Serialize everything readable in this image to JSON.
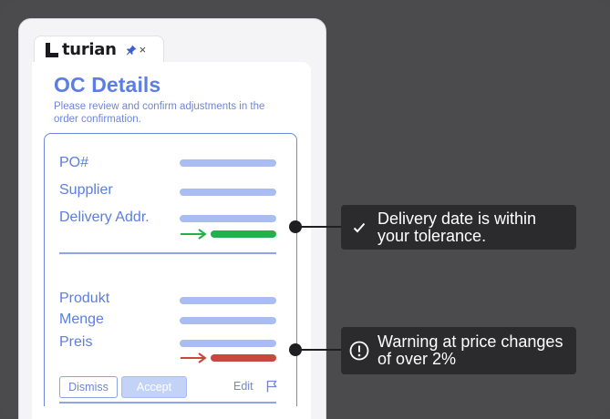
{
  "tab": {
    "brand": "turian",
    "close_symbol": "×"
  },
  "header": {
    "title": "OC Details",
    "subtitle": "Please review and confirm adjustments in the order confirmation."
  },
  "section1": {
    "po_label": "PO#",
    "supplier_label": "Supplier",
    "delivery_label": "Delivery Addr.",
    "diff_color": "#22b14c"
  },
  "section2": {
    "product_label": "Produkt",
    "quantity_label": "Menge",
    "price_label": "Preis",
    "diff_color": "#c8473e"
  },
  "actions": {
    "dismiss_label": "Dismiss",
    "accept_label": "Accept",
    "edit_label": "Edit"
  },
  "callouts": {
    "delivery": {
      "icon": "check-icon",
      "text": "Delivery date is within your tolerance."
    },
    "price": {
      "icon": "warning-circle-icon",
      "text": "Warning at price changes of over 2%"
    }
  },
  "colors": {
    "accent": "#5b7ee0",
    "bar": "#a9bdf2",
    "callout_bg": "#2b2b2e",
    "background": "#4b4b4e"
  }
}
